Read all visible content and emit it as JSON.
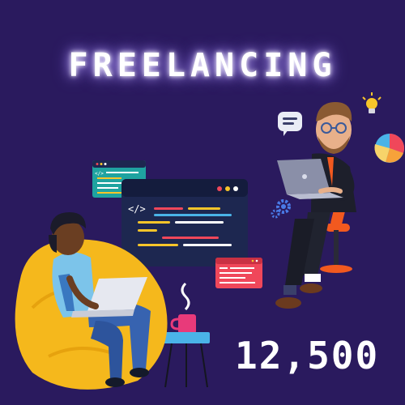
{
  "poster": {
    "title": "FREELANCING",
    "count": "12,500",
    "background_color": "#2a1a5e",
    "accent_yellow": "#f7c52a",
    "accent_red": "#f0475a",
    "accent_blue": "#4ab3e8"
  },
  "editor": {
    "tag_glyph": "</>"
  },
  "small_window": {
    "tag_glyph": "</>"
  },
  "icons": [
    "chat-bubble-icon",
    "lightbulb-icon",
    "pie-chart-icon",
    "gear-icon",
    "steam-icon"
  ]
}
